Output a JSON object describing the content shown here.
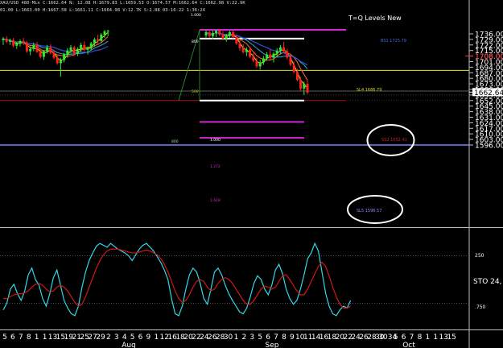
{
  "header": {
    "line1": "XAU/USD 480-Min  C:1662.64  N:  12.08  H:1679.83  L:1659.53  O:1674.57  M:1662.64  C:1662.98  V:22.9K",
    "line2": "01.00  L:1663.00  H:1667.58  L:1661.11  C:1664.98  V:12.7K  S:2.88  03-16-22  1:36:24"
  },
  "price_axis": {
    "ticks": [
      "1736.00",
      "1729.00",
      "1722.00",
      "1715.00",
      "1708.00",
      "1701.00",
      "1694.00",
      "1687.00",
      "1680.00",
      "1673.00",
      "1666.00",
      "1659.00",
      "1652.00",
      "1645.00",
      "1638.00",
      "1631.00",
      "1624.00",
      "1617.00",
      "1610.00",
      "1603.00",
      "1596.00"
    ],
    "current": "1662.64",
    "marker": "1708.00"
  },
  "osc_axis": {
    "label": "STO  24,",
    "ticks": [
      "250",
      ".750"
    ]
  },
  "time_axis": {
    "days": [
      "5",
      "6",
      "7",
      "8",
      "1",
      "1",
      "13",
      "15",
      "19",
      "21",
      "25",
      "27",
      "29",
      "2",
      "3",
      "4",
      "5",
      "6",
      "9",
      "1",
      "12",
      "16",
      "18",
      "20",
      "22",
      "24",
      "26",
      "28",
      "30",
      "1",
      "2",
      "3",
      "5",
      "6",
      "7",
      "8",
      "9",
      "10",
      "11",
      "14",
      "16",
      "18",
      "20",
      "22",
      "24",
      "26",
      "28",
      "30",
      "3034",
      "5",
      "6",
      "7",
      "8",
      "1",
      "1",
      "13",
      "15"
    ],
    "months": [
      "Aug",
      "Sep",
      "Oct"
    ]
  },
  "annotations": {
    "title": "T=Q Levels New",
    "fib_labels": [
      "1.000",
      "800",
      "500",
      "1.272",
      "1.618",
      "1.000",
      "800"
    ],
    "level_labels": [
      "BS1  1725.79",
      "SL4  1686.79",
      "SS2  1652.41",
      "SL5  1596.57"
    ]
  },
  "colors": {
    "bull": "#2eea2e",
    "bear": "#ff2020",
    "stoch": "#32d8e6",
    "signal": "#d01818",
    "yellow_line": "#e6e61c",
    "magenta": "#d028d0",
    "blue_line": "#8080ff"
  },
  "chart_data": [
    {
      "type": "candlestick",
      "title": "XAU/USD 480-Min",
      "ylim": [
        1593,
        1741
      ],
      "current_price": 1662.64,
      "sessions": [
        {
          "o": 1728,
          "h": 1732,
          "l": 1722,
          "c": 1730
        },
        {
          "o": 1730,
          "h": 1733,
          "l": 1724,
          "c": 1726
        },
        {
          "o": 1726,
          "h": 1730,
          "l": 1722,
          "c": 1728
        },
        {
          "o": 1728,
          "h": 1731,
          "l": 1719,
          "c": 1721
        },
        {
          "o": 1721,
          "h": 1726,
          "l": 1717,
          "c": 1724
        },
        {
          "o": 1724,
          "h": 1729,
          "l": 1720,
          "c": 1727
        },
        {
          "o": 1727,
          "h": 1731,
          "l": 1722,
          "c": 1725
        },
        {
          "o": 1725,
          "h": 1727,
          "l": 1712,
          "c": 1714
        },
        {
          "o": 1714,
          "h": 1720,
          "l": 1709,
          "c": 1717
        },
        {
          "o": 1717,
          "h": 1725,
          "l": 1714,
          "c": 1722
        },
        {
          "o": 1722,
          "h": 1726,
          "l": 1712,
          "c": 1713
        },
        {
          "o": 1713,
          "h": 1718,
          "l": 1705,
          "c": 1707
        },
        {
          "o": 1707,
          "h": 1716,
          "l": 1703,
          "c": 1714
        },
        {
          "o": 1714,
          "h": 1722,
          "l": 1711,
          "c": 1719
        },
        {
          "o": 1719,
          "h": 1723,
          "l": 1710,
          "c": 1712
        },
        {
          "o": 1712,
          "h": 1716,
          "l": 1704,
          "c": 1706
        },
        {
          "o": 1706,
          "h": 1709,
          "l": 1697,
          "c": 1699
        },
        {
          "o": 1699,
          "h": 1706,
          "l": 1682,
          "c": 1703
        },
        {
          "o": 1703,
          "h": 1712,
          "l": 1700,
          "c": 1710
        },
        {
          "o": 1710,
          "h": 1718,
          "l": 1706,
          "c": 1715
        },
        {
          "o": 1715,
          "h": 1722,
          "l": 1711,
          "c": 1719
        },
        {
          "o": 1719,
          "h": 1721,
          "l": 1709,
          "c": 1711
        },
        {
          "o": 1711,
          "h": 1719,
          "l": 1708,
          "c": 1717
        },
        {
          "o": 1717,
          "h": 1725,
          "l": 1713,
          "c": 1722
        },
        {
          "o": 1722,
          "h": 1727,
          "l": 1714,
          "c": 1716
        },
        {
          "o": 1716,
          "h": 1720,
          "l": 1710,
          "c": 1718
        },
        {
          "o": 1718,
          "h": 1726,
          "l": 1715,
          "c": 1724
        },
        {
          "o": 1724,
          "h": 1731,
          "l": 1720,
          "c": 1729
        },
        {
          "o": 1729,
          "h": 1735,
          "l": 1724,
          "c": 1727
        },
        {
          "o": 1727,
          "h": 1737,
          "l": 1725,
          "c": 1735
        },
        {
          "o": 1735,
          "h": 1741,
          "l": 1731,
          "c": 1739
        },
        {
          "o": 1739,
          "h": 1741,
          "l": 1733,
          "c": 1740
        },
        null,
        null,
        null,
        null,
        null,
        null,
        null,
        null,
        null,
        null,
        null,
        null,
        null,
        null,
        null,
        null,
        null,
        null,
        null,
        null,
        null,
        null,
        null,
        null,
        null,
        null,
        null,
        null,
        {
          "o": 1734,
          "h": 1741,
          "l": 1730,
          "c": 1738
        },
        {
          "o": 1738,
          "h": 1741,
          "l": 1731,
          "c": 1733
        },
        {
          "o": 1733,
          "h": 1740,
          "l": 1729,
          "c": 1737
        },
        {
          "o": 1737,
          "h": 1741,
          "l": 1732,
          "c": 1740
        },
        {
          "o": 1740,
          "h": 1741,
          "l": 1733,
          "c": 1735
        },
        {
          "o": 1735,
          "h": 1739,
          "l": 1728,
          "c": 1730
        },
        {
          "o": 1730,
          "h": 1736,
          "l": 1726,
          "c": 1734
        },
        {
          "o": 1734,
          "h": 1740,
          "l": 1731,
          "c": 1738
        },
        {
          "o": 1738,
          "h": 1741,
          "l": 1730,
          "c": 1732
        },
        {
          "o": 1732,
          "h": 1735,
          "l": 1722,
          "c": 1724
        },
        {
          "o": 1724,
          "h": 1729,
          "l": 1715,
          "c": 1718
        },
        {
          "o": 1718,
          "h": 1723,
          "l": 1711,
          "c": 1713
        },
        {
          "o": 1713,
          "h": 1719,
          "l": 1708,
          "c": 1716
        },
        {
          "o": 1716,
          "h": 1720,
          "l": 1705,
          "c": 1707
        },
        {
          "o": 1707,
          "h": 1712,
          "l": 1700,
          "c": 1702
        },
        {
          "o": 1702,
          "h": 1706,
          "l": 1693,
          "c": 1695
        },
        {
          "o": 1695,
          "h": 1703,
          "l": 1691,
          "c": 1700
        },
        {
          "o": 1700,
          "h": 1708,
          "l": 1697,
          "c": 1705
        },
        {
          "o": 1705,
          "h": 1713,
          "l": 1702,
          "c": 1710
        },
        {
          "o": 1710,
          "h": 1716,
          "l": 1704,
          "c": 1706
        },
        {
          "o": 1706,
          "h": 1713,
          "l": 1700,
          "c": 1711
        },
        {
          "o": 1711,
          "h": 1718,
          "l": 1707,
          "c": 1715
        },
        {
          "o": 1715,
          "h": 1722,
          "l": 1710,
          "c": 1719
        },
        {
          "o": 1719,
          "h": 1726,
          "l": 1712,
          "c": 1714
        },
        {
          "o": 1714,
          "h": 1717,
          "l": 1704,
          "c": 1706
        },
        {
          "o": 1706,
          "h": 1710,
          "l": 1695,
          "c": 1697
        },
        {
          "o": 1697,
          "h": 1701,
          "l": 1686,
          "c": 1688
        },
        {
          "o": 1688,
          "h": 1692,
          "l": 1676,
          "c": 1678
        },
        {
          "o": 1678,
          "h": 1682,
          "l": 1664,
          "c": 1667
        },
        {
          "o": 1667,
          "h": 1676,
          "l": 1659,
          "c": 1673
        },
        {
          "o": 1673,
          "h": 1679,
          "l": 1660,
          "c": 1662
        }
      ]
    },
    {
      "type": "line",
      "title": "STO  24,",
      "ylim": [
        0,
        100
      ],
      "series": [
        {
          "values": [
            18,
            25,
            40,
            45,
            35,
            28,
            38,
            55,
            62,
            50,
            44,
            30,
            22,
            35,
            52,
            60,
            44,
            28,
            20,
            14,
            12,
            22,
            42,
            58,
            70,
            78,
            85,
            88,
            86,
            84,
            88,
            85,
            82,
            80,
            78,
            75,
            70,
            76,
            82,
            86,
            88,
            84,
            80,
            74,
            68,
            60,
            50,
            30,
            14,
            12,
            22,
            40,
            55,
            62,
            58,
            46,
            30,
            24,
            40,
            58,
            62,
            55,
            44,
            35,
            28,
            22,
            16,
            14,
            20,
            32,
            46,
            54,
            50,
            40,
            34,
            44,
            60,
            66,
            56,
            40,
            30,
            24,
            28,
            40,
            55,
            72,
            78,
            88,
            80,
            58,
            36,
            22,
            14,
            12,
            18,
            22,
            20,
            28
          ]
        },
        {
          "values": [
            30,
            30,
            32,
            34,
            35,
            35,
            36,
            38,
            42,
            45,
            46,
            44,
            40,
            37,
            38,
            42,
            44,
            42,
            38,
            32,
            26,
            22,
            24,
            32,
            42,
            52,
            62,
            70,
            76,
            80,
            82,
            82,
            82,
            81,
            80,
            79,
            78,
            78,
            79,
            80,
            81,
            80,
            78,
            76,
            72,
            66,
            58,
            48,
            38,
            30,
            26,
            28,
            34,
            42,
            48,
            50,
            48,
            42,
            38,
            40,
            46,
            50,
            52,
            50,
            46,
            40,
            34,
            28,
            24,
            24,
            28,
            34,
            40,
            43,
            42,
            40,
            42,
            48,
            54,
            55,
            50,
            44,
            38,
            34,
            34,
            40,
            48,
            56,
            64,
            68,
            64,
            54,
            42,
            32,
            24,
            20,
            20,
            22
          ]
        }
      ]
    }
  ]
}
